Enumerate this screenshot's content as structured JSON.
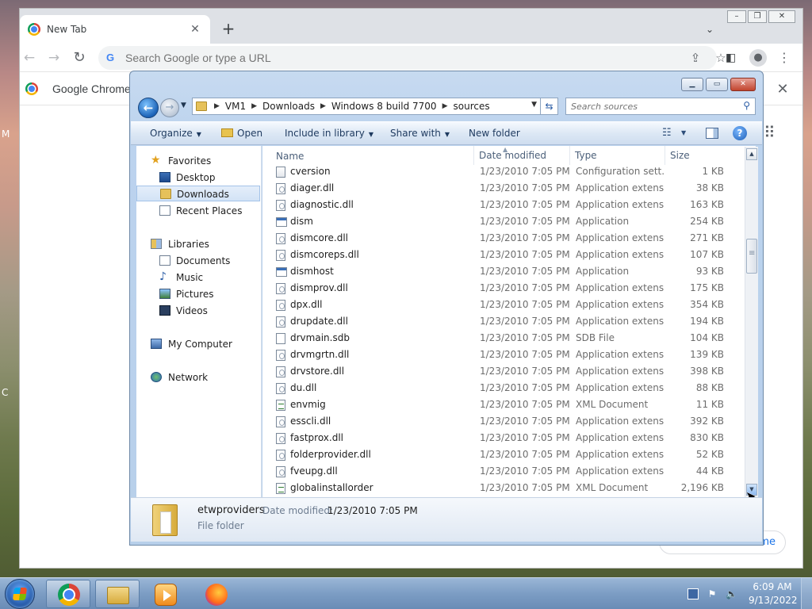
{
  "chrome": {
    "tab_title": "New Tab",
    "tab_close": "✕",
    "new_tab": "+",
    "tab_search": "⌄",
    "omnibox_placeholder": "Search Google or type a URL",
    "infobar_text": "Google Chrome i",
    "customize_text": "me",
    "win_min": "–",
    "win_max": "❐",
    "win_close": "✕"
  },
  "explorer": {
    "breadcrumbs": [
      "VM1",
      "Downloads",
      "Windows 8 build 7700",
      "sources"
    ],
    "search_placeholder": "Search sources",
    "commands": {
      "organize": "Organize",
      "open": "Open",
      "include": "Include in library",
      "share": "Share with",
      "new_folder": "New folder"
    },
    "nav": {
      "favorites": "Favorites",
      "desktop": "Desktop",
      "downloads": "Downloads",
      "recent": "Recent Places",
      "libraries": "Libraries",
      "documents": "Documents",
      "music": "Music",
      "pictures": "Pictures",
      "videos": "Videos",
      "computer": "My Computer",
      "network": "Network"
    },
    "selected_nav": "Downloads",
    "columns": {
      "name": "Name",
      "date": "Date modified",
      "type": "Type",
      "size": "Size"
    },
    "files": [
      {
        "name": "cversion",
        "date": "1/23/2010 7:05 PM",
        "type": "Configuration sett...",
        "size": "1 KB",
        "icon": "cfg"
      },
      {
        "name": "diager.dll",
        "date": "1/23/2010 7:05 PM",
        "type": "Application extens...",
        "size": "38 KB",
        "icon": "dll"
      },
      {
        "name": "diagnostic.dll",
        "date": "1/23/2010 7:05 PM",
        "type": "Application extens...",
        "size": "163 KB",
        "icon": "dll"
      },
      {
        "name": "dism",
        "date": "1/23/2010 7:05 PM",
        "type": "Application",
        "size": "254 KB",
        "icon": "app"
      },
      {
        "name": "dismcore.dll",
        "date": "1/23/2010 7:05 PM",
        "type": "Application extens...",
        "size": "271 KB",
        "icon": "dll"
      },
      {
        "name": "dismcoreps.dll",
        "date": "1/23/2010 7:05 PM",
        "type": "Application extens...",
        "size": "107 KB",
        "icon": "dll"
      },
      {
        "name": "dismhost",
        "date": "1/23/2010 7:05 PM",
        "type": "Application",
        "size": "93 KB",
        "icon": "app"
      },
      {
        "name": "dismprov.dll",
        "date": "1/23/2010 7:05 PM",
        "type": "Application extens...",
        "size": "175 KB",
        "icon": "dll"
      },
      {
        "name": "dpx.dll",
        "date": "1/23/2010 7:05 PM",
        "type": "Application extens...",
        "size": "354 KB",
        "icon": "dll"
      },
      {
        "name": "drupdate.dll",
        "date": "1/23/2010 7:05 PM",
        "type": "Application extens...",
        "size": "194 KB",
        "icon": "dll"
      },
      {
        "name": "drvmain.sdb",
        "date": "1/23/2010 7:05 PM",
        "type": "SDB File",
        "size": "104 KB",
        "icon": "file"
      },
      {
        "name": "drvmgrtn.dll",
        "date": "1/23/2010 7:05 PM",
        "type": "Application extens...",
        "size": "139 KB",
        "icon": "dll"
      },
      {
        "name": "drvstore.dll",
        "date": "1/23/2010 7:05 PM",
        "type": "Application extens...",
        "size": "398 KB",
        "icon": "dll"
      },
      {
        "name": "du.dll",
        "date": "1/23/2010 7:05 PM",
        "type": "Application extens...",
        "size": "88 KB",
        "icon": "dll"
      },
      {
        "name": "envmig",
        "date": "1/23/2010 7:05 PM",
        "type": "XML Document",
        "size": "11 KB",
        "icon": "xml"
      },
      {
        "name": "esscli.dll",
        "date": "1/23/2010 7:05 PM",
        "type": "Application extens...",
        "size": "392 KB",
        "icon": "dll"
      },
      {
        "name": "fastprox.dll",
        "date": "1/23/2010 7:05 PM",
        "type": "Application extens...",
        "size": "830 KB",
        "icon": "dll"
      },
      {
        "name": "folderprovider.dll",
        "date": "1/23/2010 7:05 PM",
        "type": "Application extens...",
        "size": "52 KB",
        "icon": "dll"
      },
      {
        "name": "fveupg.dll",
        "date": "1/23/2010 7:05 PM",
        "type": "Application extens...",
        "size": "44 KB",
        "icon": "dll"
      },
      {
        "name": "globalinstallorder",
        "date": "1/23/2010 7:05 PM",
        "type": "XML Document",
        "size": "2,196 KB",
        "icon": "xml"
      }
    ],
    "details": {
      "name": "etwproviders",
      "date_label": "Date modified:",
      "date": "1/23/2010 7:05 PM",
      "type": "File folder"
    }
  },
  "taskbar": {
    "time": "6:09 AM",
    "date": "9/13/2022"
  },
  "colors": {
    "explorer_frame": "#bcd3ee",
    "selection": "#d3e3f6",
    "taskbar": "#7c9dc4"
  }
}
